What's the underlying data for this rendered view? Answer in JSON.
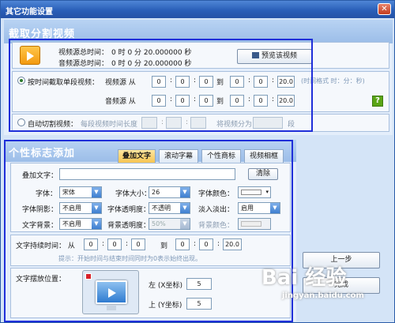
{
  "window": {
    "title": "其它功能设置",
    "close_glyph": "✕"
  },
  "split": {
    "title": "截取分割视频",
    "video_total_label": "视频源总时间：",
    "video_total_value": "0  时 0  分 20.000000 秒",
    "audio_total_label": "音频源总时间：",
    "audio_total_value": "0  时 0  分 20.000000 秒",
    "preview_button": "预览该视频",
    "by_time_label": "按时间截取单段视频：",
    "video_src_label": "视频源  从",
    "audio_src_label": "音频源  从",
    "to_label": "到",
    "time_from": [
      "0",
      "0",
      "0"
    ],
    "time_to": [
      "0",
      "0",
      "20.0"
    ],
    "hint": "(时间格式 时：分：秒)",
    "auto_cut_label": "自动切割视频：",
    "segment_length_label": "每段视频时间长度",
    "split_into_label": "将视频分为",
    "segment_unit": "段"
  },
  "logo": {
    "title": "个性标志添加",
    "tabs": [
      "叠加文字",
      "滚动字幕",
      "个性商标",
      "视频相框"
    ],
    "overlay_text_label": "叠加文字：",
    "overlay_text_value": "",
    "clear_button": "清除",
    "font_label": "字体：",
    "font_value": "宋体",
    "font_size_label": "字体大小：",
    "font_size_value": "26",
    "font_color_label": "字体颜色：",
    "font_shadow_label": "字体阴影：",
    "font_shadow_value": "不启用",
    "font_opacity_label": "字体透明度：",
    "font_opacity_value": "不透明",
    "fade_label": "淡入淡出：",
    "fade_value": "启用",
    "text_bg_label": "文字背景：",
    "text_bg_value": "不启用",
    "bg_opacity_label": "背景透明度：",
    "bg_opacity_value": "50%",
    "bg_color_label": "背景颜色：",
    "duration_label": "文字持续时间：  从",
    "dur_from": [
      "0",
      "0",
      "0"
    ],
    "dur_to": [
      "0",
      "0",
      "20.0"
    ],
    "to_label": "到",
    "duration_hint": "提示：开始时间与结束时间同时为0表示始终出现。",
    "position_label": "文字摆放位置：",
    "left_label": "左 (X坐标)",
    "left_value": "5",
    "top_label": "上 (Y坐标)",
    "top_value": "5"
  },
  "buttons": {
    "prev": "上一步",
    "next": "完成"
  },
  "watermark": {
    "brand": "Bai 经验",
    "url": "jingyan.baidu.com"
  },
  "colors": {
    "frame": "#1f2fd9",
    "hint": "#7f99b8",
    "icon_green": "#5aa515"
  }
}
